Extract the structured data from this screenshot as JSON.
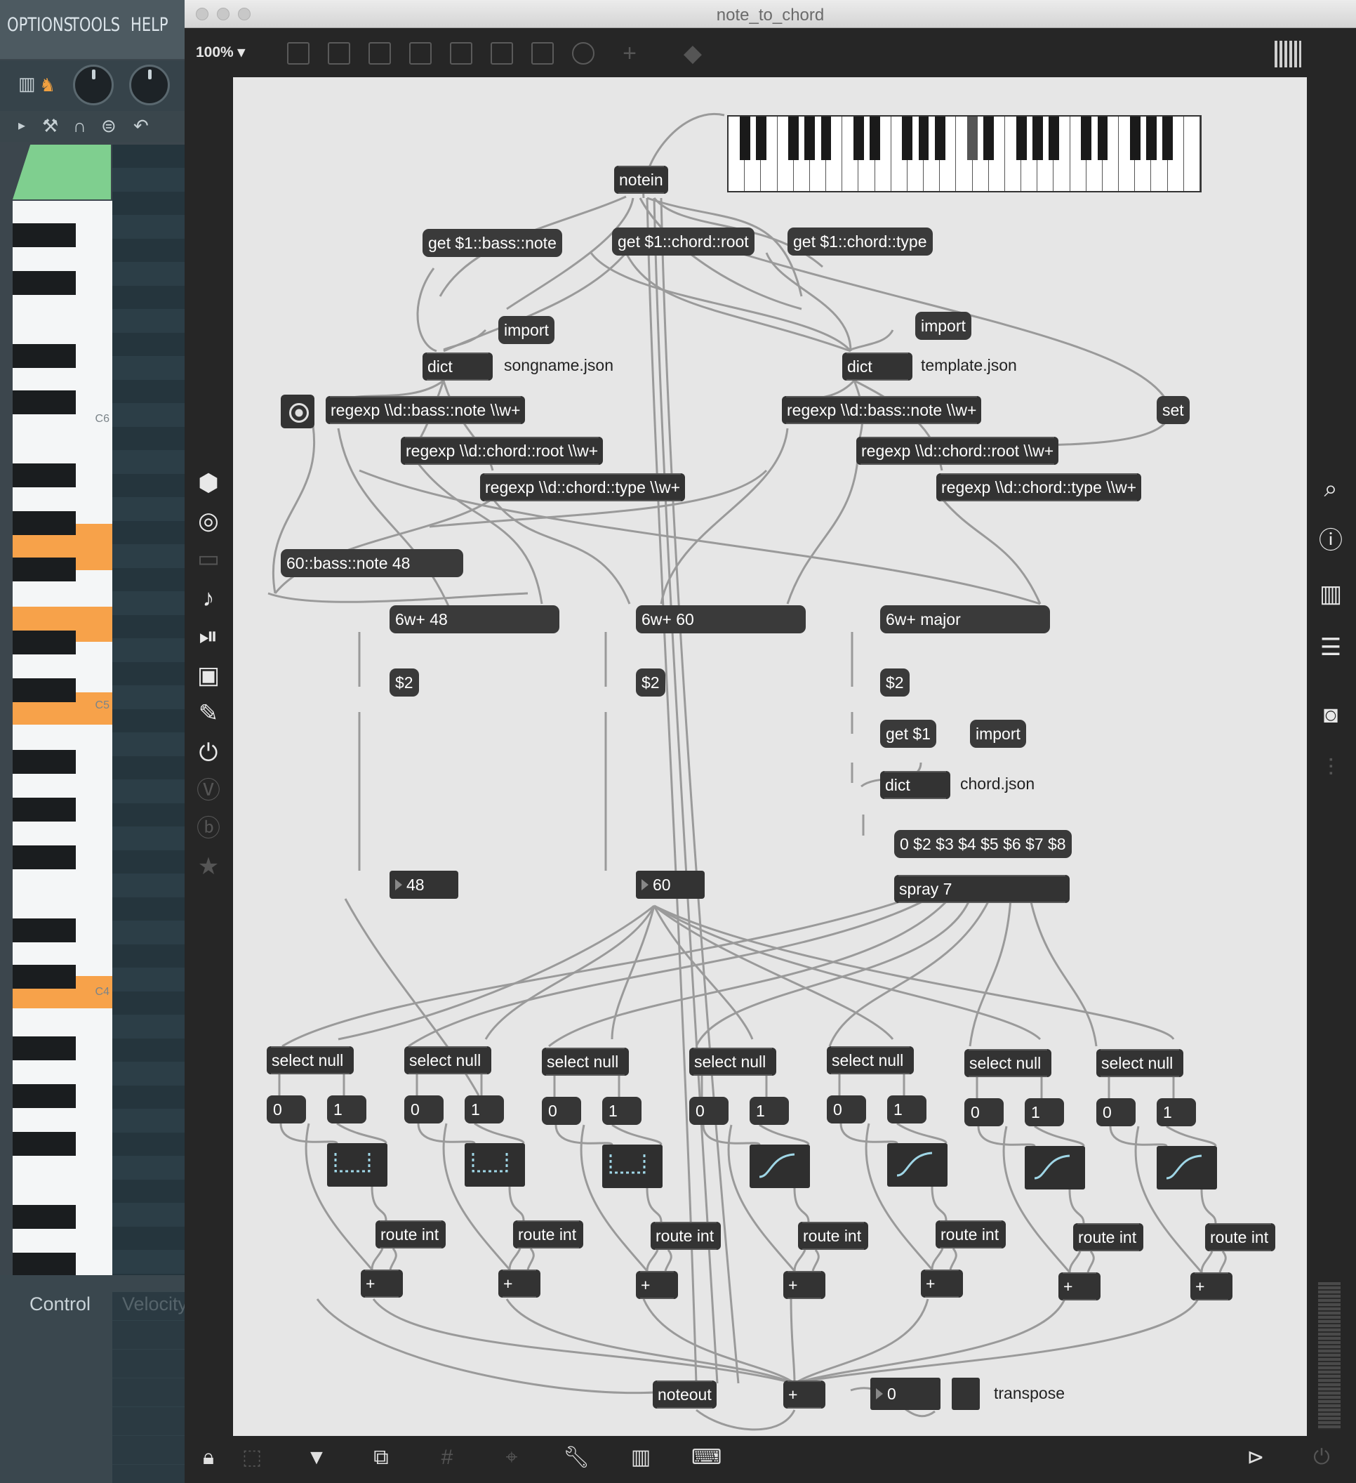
{
  "fl": {
    "menu": [
      "OPTIONS",
      "TOOLS",
      "HELP"
    ],
    "octaves": [
      "C6",
      "C5",
      "C4"
    ],
    "control_label": "Control",
    "velocity_label": "Velocity"
  },
  "window": {
    "title": "note_to_chord",
    "zoom": "100%"
  },
  "patch": {
    "notein": "notein",
    "get_bass": "get $1::bass::note",
    "get_root": "get $1::chord::root",
    "get_type": "get $1::chord::type",
    "import": "import",
    "dict": "dict",
    "songname": "songname.json",
    "template": "template.json",
    "chordfile": "chord.json",
    "set": "set",
    "regexp_bass": "regexp \\\\d::bass::note \\\\w+",
    "regexp_root": "regexp \\\\d::chord::root \\\\w+",
    "regexp_type": "regexp \\\\d::chord::type \\\\w+",
    "bass_msg": "60::bass::note 48",
    "w48": "6w+ 48",
    "w60": "6w+ 60",
    "wmajor": "6w+ major",
    "s2": "$2",
    "get1": "get $1",
    "list_msg": "0 $2 $3 $4 $5 $6 $7 $8",
    "num48": "48",
    "num60": "60",
    "spray": "spray 7",
    "select": "select null",
    "zero": "0",
    "one": "1",
    "route": "route int",
    "plus": "+",
    "noteout": "noteout",
    "transpose_val": "0",
    "transpose": "transpose"
  }
}
